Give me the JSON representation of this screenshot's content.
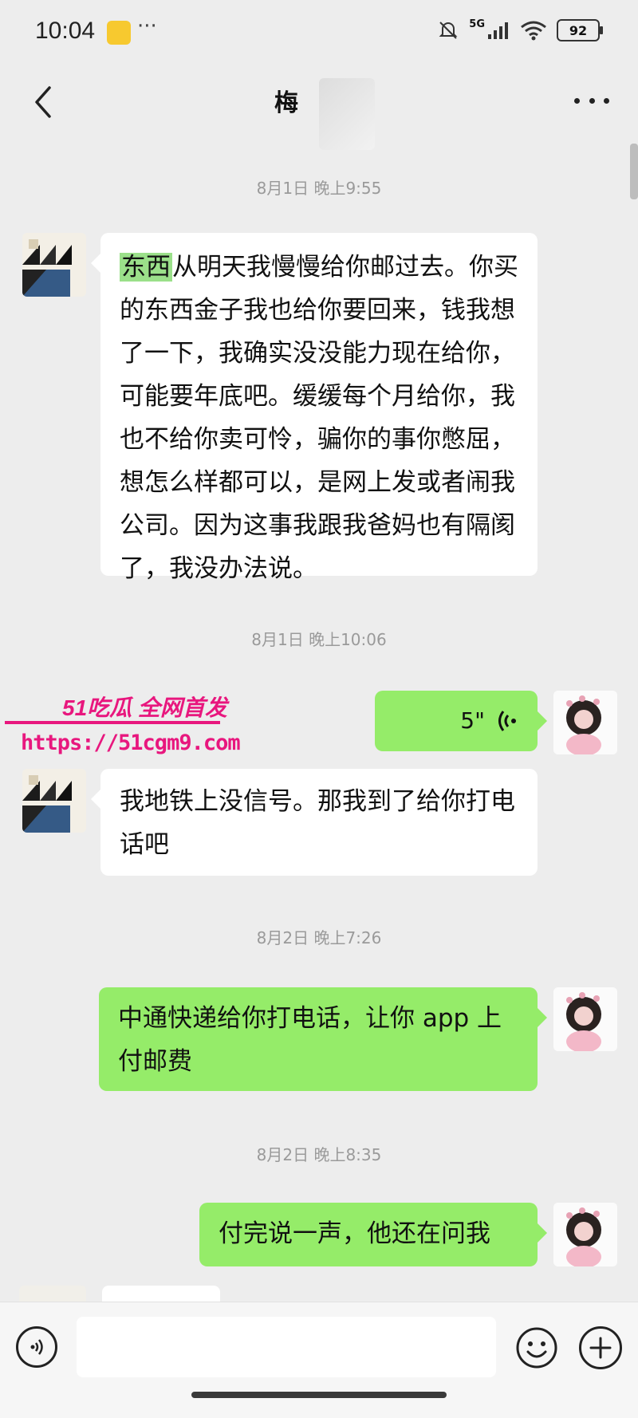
{
  "status_bar": {
    "time": "10:04",
    "more": "···",
    "network": "5G",
    "battery": "92"
  },
  "header": {
    "title": "梅"
  },
  "messages": [
    {
      "type": "timestamp",
      "text": "8月1日 晚上9:55"
    },
    {
      "type": "text",
      "side": "left",
      "highlight": "东西",
      "text": "从明天我慢慢给你邮过去。你买的东西金子我也给你要回来，钱我想了一下，我确实没没能力现在给你，可能要年底吧。缓缓每个月给你，我也不给你卖可怜，骗你的事你憋屈，想怎么样都可以，是网上发或者闹我公司。因为这事我跟我爸妈也有隔阂了，我没办法说。"
    },
    {
      "type": "timestamp",
      "text": "8月1日 晚上10:06"
    },
    {
      "type": "voice",
      "side": "right",
      "duration": "5\""
    },
    {
      "type": "text",
      "side": "left",
      "text": "我地铁上没信号。那我到了给你打电话吧"
    },
    {
      "type": "timestamp",
      "text": "8月2日 晚上7:26"
    },
    {
      "type": "text",
      "side": "right",
      "text": "中通快递给你打电话，让你 app 上付邮费"
    },
    {
      "type": "timestamp",
      "text": "8月2日 晚上8:35"
    },
    {
      "type": "text",
      "side": "right",
      "text": "付完说一声，他还在问我"
    }
  ],
  "watermark": {
    "line1": "51吃瓜 全网首发",
    "line2": "https://51cgm9.com"
  },
  "input": {
    "placeholder": ""
  },
  "colors": {
    "background": "#ededed",
    "bubble_out": "#95ec69",
    "bubble_in": "#ffffff",
    "watermark": "#e8177e"
  },
  "icons": [
    "back-arrow-icon",
    "more-icon",
    "voice-wave-icon",
    "voice-input-icon",
    "emoji-icon",
    "plus-icon"
  ]
}
